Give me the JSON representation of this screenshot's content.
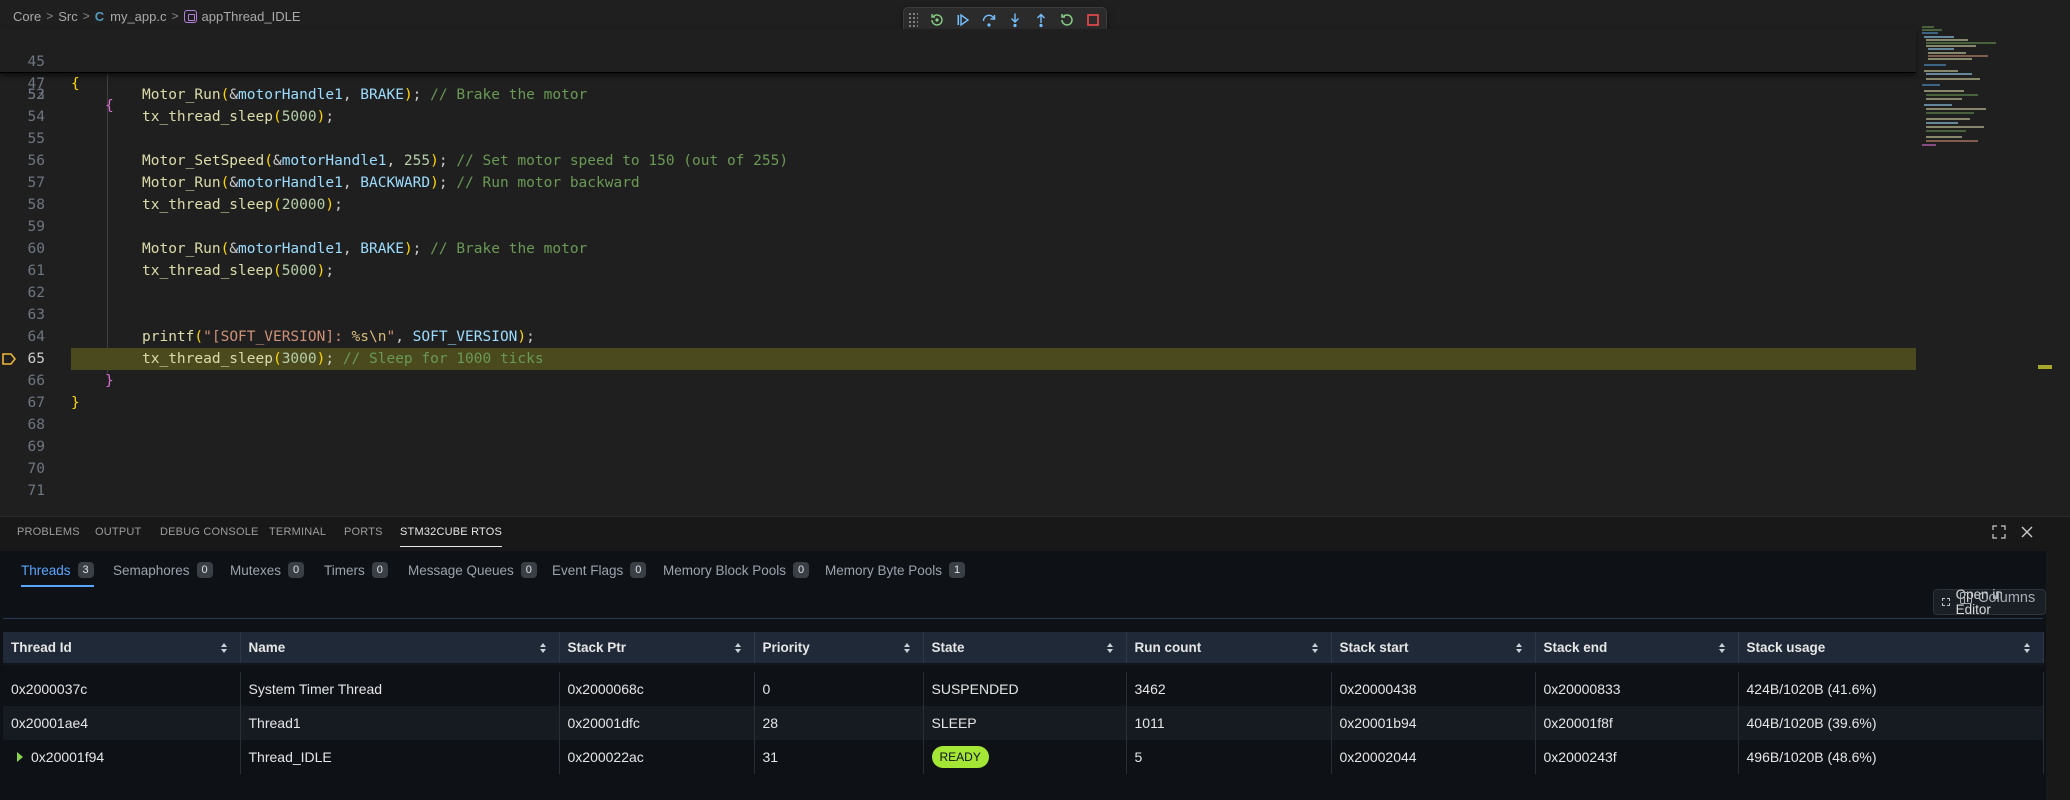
{
  "breadcrumb": {
    "items": [
      "Core",
      "Src",
      "my_app.c",
      "appThread_IDLE"
    ],
    "file_icon_glyph": "C",
    "separator": ">"
  },
  "debug_toolbar": {
    "icons": [
      "drag-handle-icon",
      "restart-frame-icon",
      "continue-icon",
      "step-over-icon",
      "step-into-icon",
      "step-out-icon",
      "restart-icon",
      "stop-icon"
    ]
  },
  "editor": {
    "current_line": 65,
    "sticky_lines": [
      {
        "num": "45",
        "text": "{"
      },
      {
        "num": "47",
        "text": "{"
      }
    ],
    "visible_top_number": "52",
    "lines": [
      {
        "num": "53",
        "tokens": [
          [
            "t-fn",
            "Motor_Run"
          ],
          [
            "br1",
            "("
          ],
          [
            "t-pl",
            "&"
          ],
          [
            "t-var",
            "motorHandle1"
          ],
          [
            "t-pl",
            ", "
          ],
          [
            "t-var",
            "BRAKE"
          ],
          [
            "br1",
            ")"
          ],
          [
            "t-pl",
            "; "
          ],
          [
            "t-cm",
            "// Brake the motor"
          ]
        ]
      },
      {
        "num": "54",
        "tokens": [
          [
            "t-fn",
            "tx_thread_sleep"
          ],
          [
            "br1",
            "("
          ],
          [
            "t-num",
            "5000"
          ],
          [
            "br1",
            ")"
          ],
          [
            "t-pl",
            ";"
          ]
        ]
      },
      {
        "num": "55",
        "tokens": []
      },
      {
        "num": "56",
        "tokens": [
          [
            "t-fn",
            "Motor_SetSpeed"
          ],
          [
            "br1",
            "("
          ],
          [
            "t-pl",
            "&"
          ],
          [
            "t-var",
            "motorHandle1"
          ],
          [
            "t-pl",
            ", "
          ],
          [
            "t-num",
            "255"
          ],
          [
            "br1",
            ")"
          ],
          [
            "t-pl",
            "; "
          ],
          [
            "t-cm",
            "// Set motor speed to 150 (out of 255)"
          ]
        ]
      },
      {
        "num": "57",
        "tokens": [
          [
            "t-fn",
            "Motor_Run"
          ],
          [
            "br1",
            "("
          ],
          [
            "t-pl",
            "&"
          ],
          [
            "t-var",
            "motorHandle1"
          ],
          [
            "t-pl",
            ", "
          ],
          [
            "t-var",
            "BACKWARD"
          ],
          [
            "br1",
            ")"
          ],
          [
            "t-pl",
            "; "
          ],
          [
            "t-cm",
            "// Run motor backward"
          ]
        ]
      },
      {
        "num": "58",
        "tokens": [
          [
            "t-fn",
            "tx_thread_sleep"
          ],
          [
            "br1",
            "("
          ],
          [
            "t-num",
            "20000"
          ],
          [
            "br1",
            ")"
          ],
          [
            "t-pl",
            ";"
          ]
        ]
      },
      {
        "num": "59",
        "tokens": []
      },
      {
        "num": "60",
        "tokens": [
          [
            "t-fn",
            "Motor_Run"
          ],
          [
            "br1",
            "("
          ],
          [
            "t-pl",
            "&"
          ],
          [
            "t-var",
            "motorHandle1"
          ],
          [
            "t-pl",
            ", "
          ],
          [
            "t-var",
            "BRAKE"
          ],
          [
            "br1",
            ")"
          ],
          [
            "t-pl",
            "; "
          ],
          [
            "t-cm",
            "// Brake the motor"
          ]
        ]
      },
      {
        "num": "61",
        "tokens": [
          [
            "t-fn",
            "tx_thread_sleep"
          ],
          [
            "br1",
            "("
          ],
          [
            "t-num",
            "5000"
          ],
          [
            "br1",
            ")"
          ],
          [
            "t-pl",
            ";"
          ]
        ]
      },
      {
        "num": "62",
        "tokens": []
      },
      {
        "num": "63",
        "tokens": []
      },
      {
        "num": "64",
        "tokens": [
          [
            "t-fn",
            "printf"
          ],
          [
            "br1",
            "("
          ],
          [
            "t-str",
            "\"[SOFT_VERSION]: "
          ],
          [
            "t-esc",
            "%s\\n"
          ],
          [
            "t-str",
            "\""
          ],
          [
            "t-pl",
            ", "
          ],
          [
            "t-var",
            "SOFT_VERSION"
          ],
          [
            "br1",
            ")"
          ],
          [
            "t-pl",
            ";"
          ]
        ]
      },
      {
        "num": "65",
        "tokens": [
          [
            "t-fn",
            "tx_thread_sleep"
          ],
          [
            "br1",
            "("
          ],
          [
            "t-num",
            "3000"
          ],
          [
            "br1",
            ")"
          ],
          [
            "t-pl",
            "; "
          ],
          [
            "t-cm",
            "// Sleep for 1000 ticks"
          ]
        ]
      },
      {
        "num": "66",
        "tokens": [
          [
            "br2",
            "}"
          ]
        ]
      },
      {
        "num": "67",
        "tokens": [
          [
            "br1",
            "}"
          ]
        ]
      },
      {
        "num": "68",
        "tokens": []
      },
      {
        "num": "69",
        "tokens": []
      },
      {
        "num": "70",
        "tokens": []
      },
      {
        "num": "71",
        "tokens": []
      }
    ]
  },
  "panel": {
    "tabs": [
      "PROBLEMS",
      "OUTPUT",
      "DEBUG CONSOLE",
      "TERMINAL",
      "PORTS",
      "STM32CUBE RTOS"
    ],
    "active_tab": "STM32CUBE RTOS",
    "actions": [
      "maximize-panel-icon",
      "close-panel-icon"
    ]
  },
  "rtos": {
    "tabs": [
      {
        "label": "Threads",
        "count": "3"
      },
      {
        "label": "Semaphores",
        "count": "0"
      },
      {
        "label": "Mutexes",
        "count": "0"
      },
      {
        "label": "Timers",
        "count": "0"
      },
      {
        "label": "Message Queues",
        "count": "0"
      },
      {
        "label": "Event Flags",
        "count": "0"
      },
      {
        "label": "Memory Block Pools",
        "count": "0"
      },
      {
        "label": "Memory Byte Pools",
        "count": "1"
      }
    ],
    "active_tab": "Threads",
    "open_in_editor_label": "Open in Editor",
    "columns_label": "Columns",
    "table": {
      "headers": [
        "Thread Id",
        "Name",
        "Stack Ptr",
        "Priority",
        "State",
        "Run count",
        "Stack start",
        "Stack end",
        "Stack usage"
      ],
      "rows": [
        [
          "0x2000037c",
          "System Timer Thread",
          "0x2000068c",
          "0",
          "SUSPENDED",
          "3462",
          "0x20000438",
          "0x20000833",
          "424B/1020B (41.6%)"
        ],
        [
          "0x20001ae4",
          "Thread1",
          "0x20001dfc",
          "28",
          "SLEEP",
          "1011",
          "0x20001b94",
          "0x20001f8f",
          "404B/1020B (39.6%)"
        ],
        [
          "0x20001f94",
          "Thread_IDLE",
          "0x200022ac",
          "31",
          "READY",
          "5",
          "0x20002044",
          "0x2000243f",
          "496B/1020B (48.6%)"
        ]
      ],
      "expandable_row": 2,
      "badge_state": "READY"
    }
  },
  "colors": {
    "accent": "#58a6ff",
    "ready_badge": "#a3e635",
    "current_line_highlight": "#4b4a1f",
    "breakpoint_arrow": "#f0b53b",
    "debug_stop": "#f14c4c",
    "debug_green": "#89d185",
    "debug_blue": "#75beff"
  }
}
